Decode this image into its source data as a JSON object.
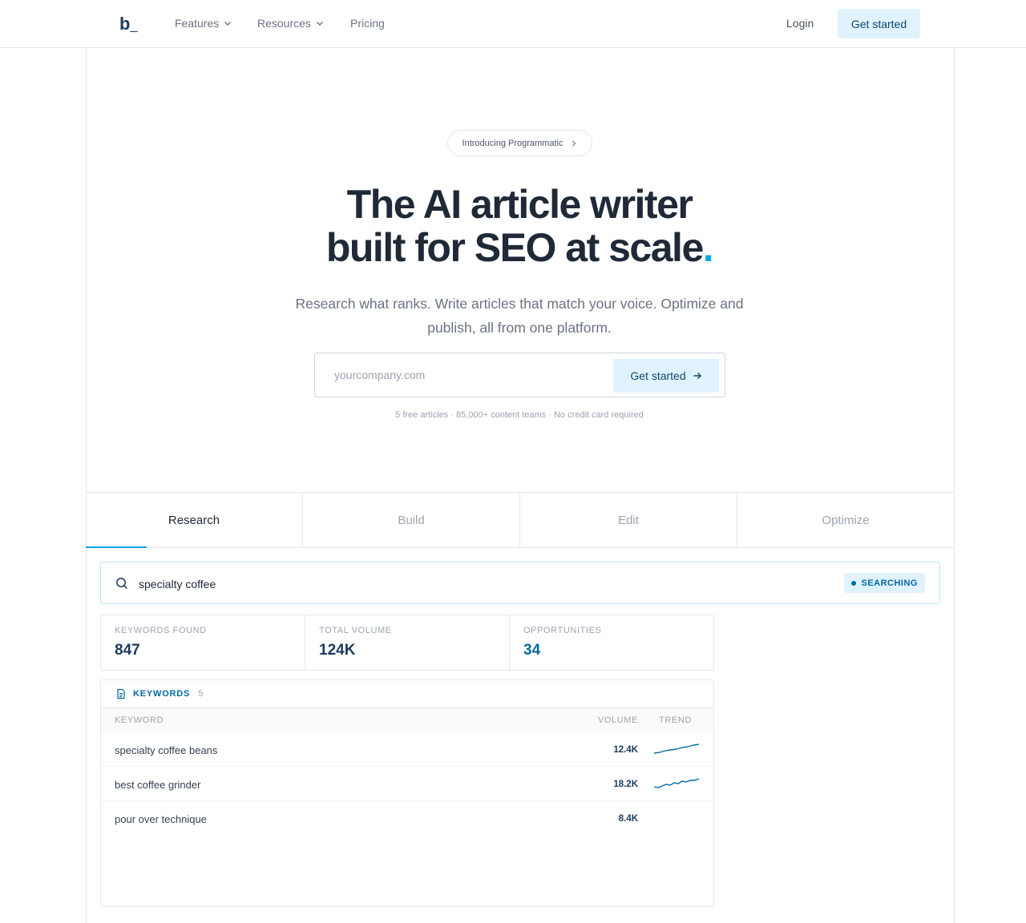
{
  "nav": {
    "logo": "b",
    "logo_cursor": "_",
    "features": "Features",
    "resources": "Resources",
    "pricing": "Pricing",
    "login": "Login",
    "cta": "Get started"
  },
  "hero": {
    "pill": "Introducing Programmatic",
    "title_line1": "The AI article writer",
    "title_line2": "built for SEO at scale",
    "title_dot": ".",
    "subtitle": "Research what ranks. Write articles that match your voice. Optimize and publish, all from one platform.",
    "input_placeholder": "yourcompany.com",
    "cta": "Get started",
    "fineprint": "5 free articles · 85,000+ content teams · No credit card required"
  },
  "tabs": [
    "Research",
    "Build",
    "Edit",
    "Optimize"
  ],
  "search": {
    "query": "specialty coffee",
    "status": "SEARCHING"
  },
  "stats": [
    {
      "label": "KEYWORDS FOUND",
      "value": "847"
    },
    {
      "label": "TOTAL VOLUME",
      "value": "124K"
    },
    {
      "label": "OPPORTUNITIES",
      "value": "34"
    }
  ],
  "keywords": {
    "title": "KEYWORDS",
    "count": "5",
    "col_keyword": "KEYWORD",
    "col_volume": "VOLUME",
    "col_trend": "TREND",
    "rows": [
      {
        "keyword": "specialty coffee beans",
        "volume": "12.4K"
      },
      {
        "keyword": "best coffee grinder",
        "volume": "18.2K"
      },
      {
        "keyword": "pour over technique",
        "volume": "8.4K"
      }
    ]
  },
  "colors": {
    "accent": "#0ea5e9",
    "cta_bg": "#e0f2fe",
    "cta_text": "#0c4a6e",
    "navy": "#1e3a5f"
  }
}
